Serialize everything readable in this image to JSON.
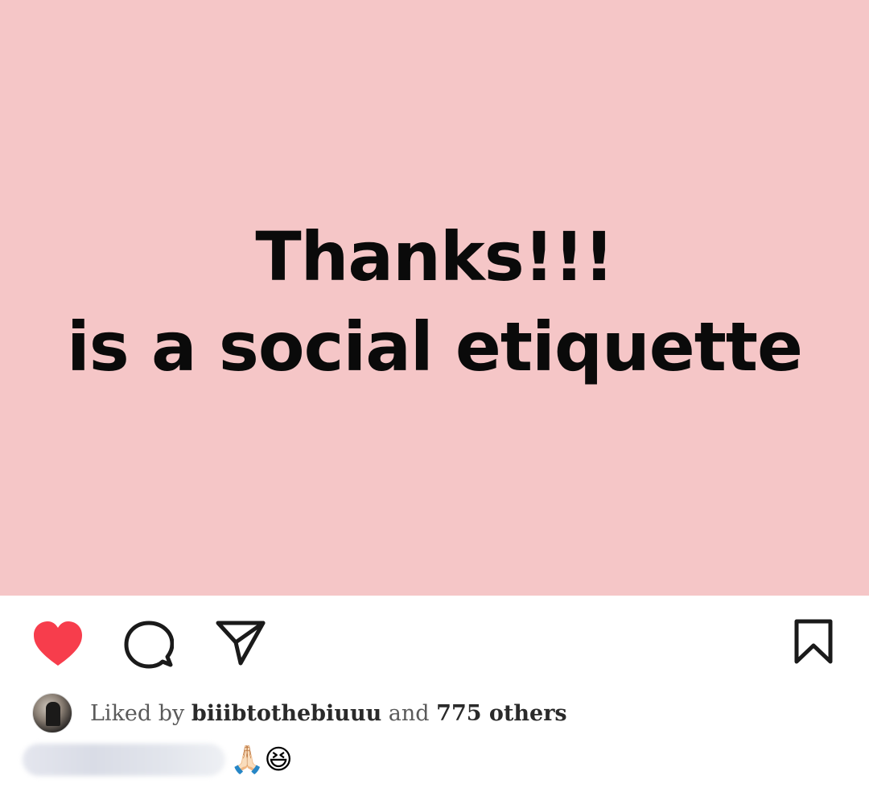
{
  "post": {
    "background_color": "#F5C6C7",
    "text_line1": "Thanks!!!",
    "text_line2": "is a social etiquette"
  },
  "actions": {
    "like_icon": "heart-filled-icon",
    "like_color": "#F73D4C",
    "comment_icon": "comment-bubble-icon",
    "share_icon": "paper-plane-icon",
    "save_icon": "bookmark-icon"
  },
  "likes": {
    "prefix": "Liked by ",
    "username": "biiibtothebiuuu",
    "middle": " and ",
    "others": "775 others"
  },
  "caption": {
    "emojis": "🙏🏻😆"
  }
}
